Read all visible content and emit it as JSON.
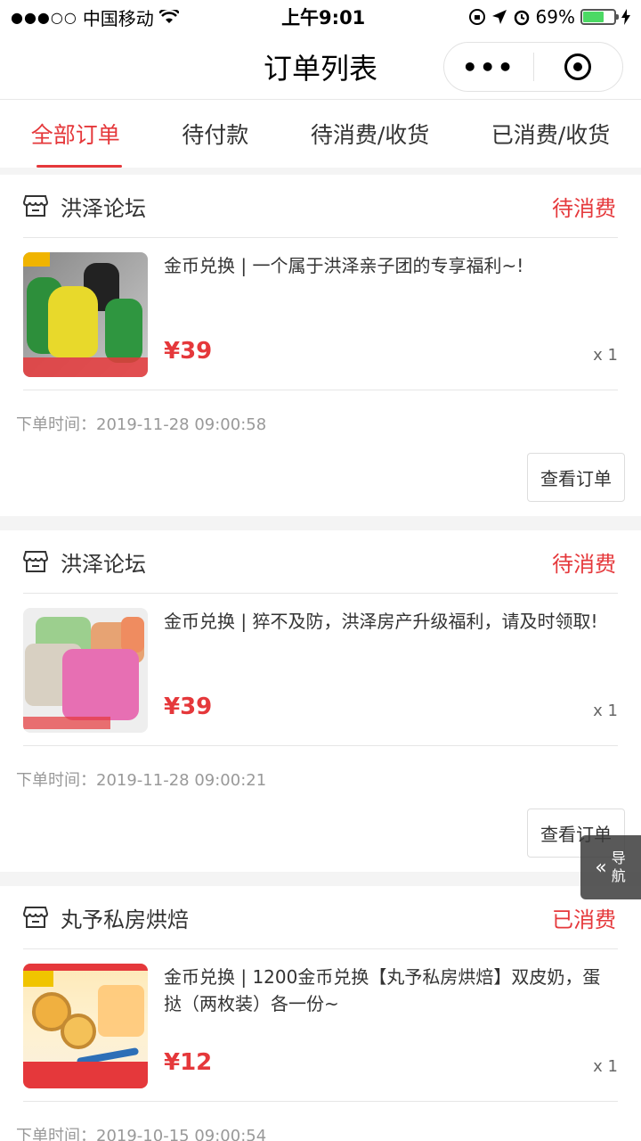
{
  "status_bar": {
    "signal_dots": "●●●○○",
    "carrier": "中国移动",
    "wifi_icon": "wifi-icon",
    "time": "上午9:01",
    "battery_percent": "69%",
    "battery_level": 0.69
  },
  "navbar": {
    "title": "订单列表",
    "more_label": "•••"
  },
  "tabs": [
    {
      "label": "全部订单",
      "active": true
    },
    {
      "label": "待付款",
      "active": false
    },
    {
      "label": "待消费/收货",
      "active": false
    },
    {
      "label": "已消费/收货",
      "active": false
    }
  ],
  "orders": [
    {
      "shop": "洪泽论坛",
      "status": "待消费",
      "title": "金币兑换 | 一个属于洪泽亲子团的专享福利~!",
      "price": "¥39",
      "qty": "x 1",
      "time": "下单时间：2019-11-28 09:00:58",
      "action": "查看订单"
    },
    {
      "shop": "洪泽论坛",
      "status": "待消费",
      "title": "金币兑换 | 猝不及防，洪泽房产升级福利，请及时领取!",
      "price": "¥39",
      "qty": "x 1",
      "time": "下单时间：2019-11-28 09:00:21",
      "action": "查看订单"
    },
    {
      "shop": "丸予私房烘焙",
      "status": "已消费",
      "title": "金币兑换 | 1200金币兑换【丸予私房烘焙】双皮奶，蛋挞（两枚装）各一份~",
      "price": "¥12",
      "qty": "x 1",
      "time": "下单时间：2019-10-15 09:00:54"
    }
  ],
  "float_nav": {
    "label": "导航"
  },
  "colors": {
    "accent": "#e5383b",
    "muted_text": "#999999"
  }
}
